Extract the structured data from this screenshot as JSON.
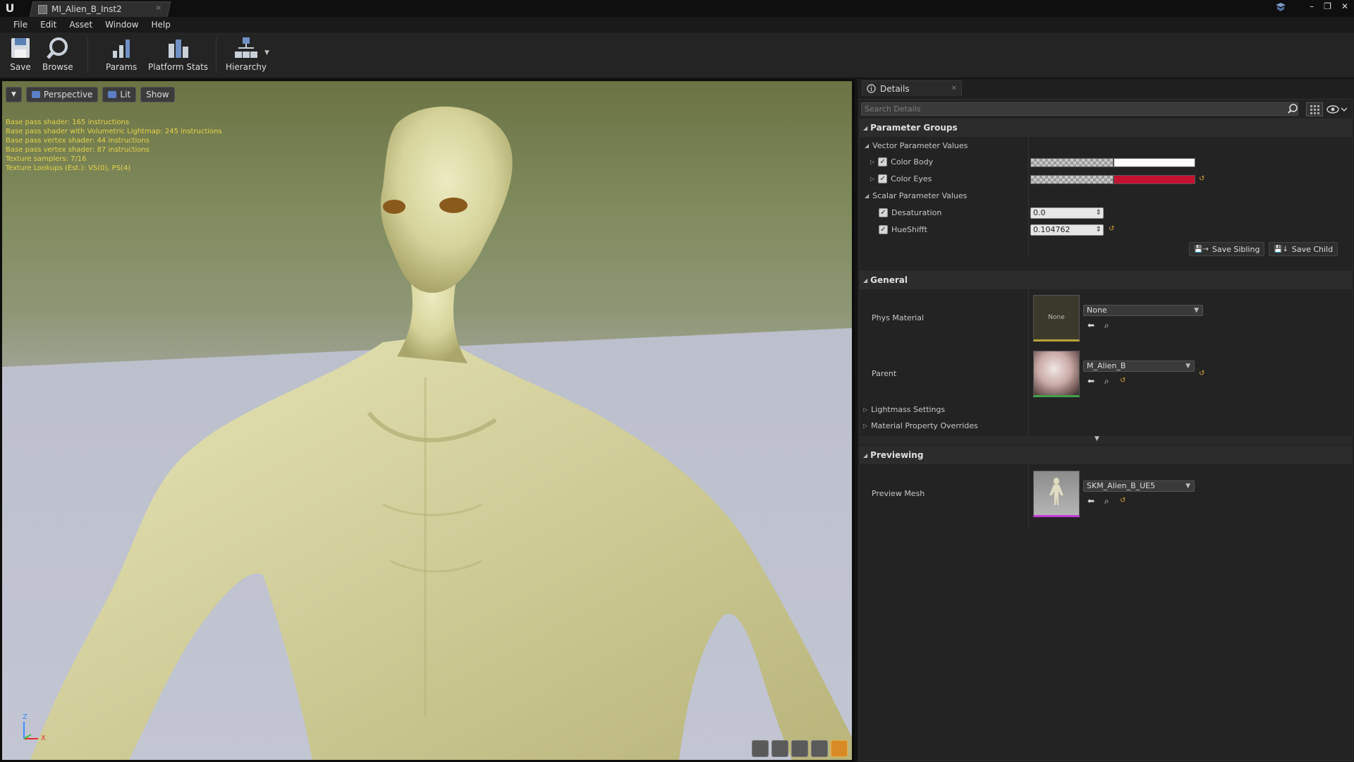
{
  "window": {
    "tab_title": "MI_Alien_B_Inst2",
    "controls": [
      "–",
      "❐",
      "✕"
    ]
  },
  "menu": [
    "File",
    "Edit",
    "Asset",
    "Window",
    "Help"
  ],
  "toolbar": {
    "save": "Save",
    "browse": "Browse",
    "params": "Params",
    "platform_stats": "Platform Stats",
    "hierarchy": "Hierarchy"
  },
  "viewport": {
    "perspective": "Perspective",
    "lit": "Lit",
    "show": "Show",
    "stats": [
      "Base pass shader: 165 instructions",
      "Base pass shader with Volumetric Lightmap: 245 instructions",
      "Base pass vertex shader: 44 instructions",
      "Base pass vertex shader: 87 instructions",
      "Texture samplers: 7/16",
      "Texture Lookups (Est.): VS(0), PS(4)"
    ],
    "axis": {
      "z": "Z",
      "x": "X"
    }
  },
  "details": {
    "tab_label": "Details",
    "search_placeholder": "Search Details",
    "parameter_groups": {
      "title": "Parameter Groups",
      "vector_title": "Vector Parameter Values",
      "vectors": [
        {
          "name": "Color Body",
          "color": "#ffffff"
        },
        {
          "name": "Color Eyes",
          "color": "#c41230"
        }
      ],
      "scalar_title": "Scalar Parameter Values",
      "scalars": [
        {
          "name": "Desaturation",
          "value": "0.0"
        },
        {
          "name": "HueShifft",
          "value": "0.104762"
        }
      ],
      "save_sibling": "Save Sibling",
      "save_child": "Save Child"
    },
    "general": {
      "title": "General",
      "phys_material_label": "Phys Material",
      "phys_material_thumb": "None",
      "phys_material_value": "None",
      "parent_label": "Parent",
      "parent_value": "M_Alien_B",
      "lightmass": "Lightmass Settings",
      "material_overrides": "Material Property Overrides"
    },
    "previewing": {
      "title": "Previewing",
      "preview_mesh_label": "Preview Mesh",
      "preview_mesh_value": "SKM_Alien_B_UE5"
    }
  }
}
